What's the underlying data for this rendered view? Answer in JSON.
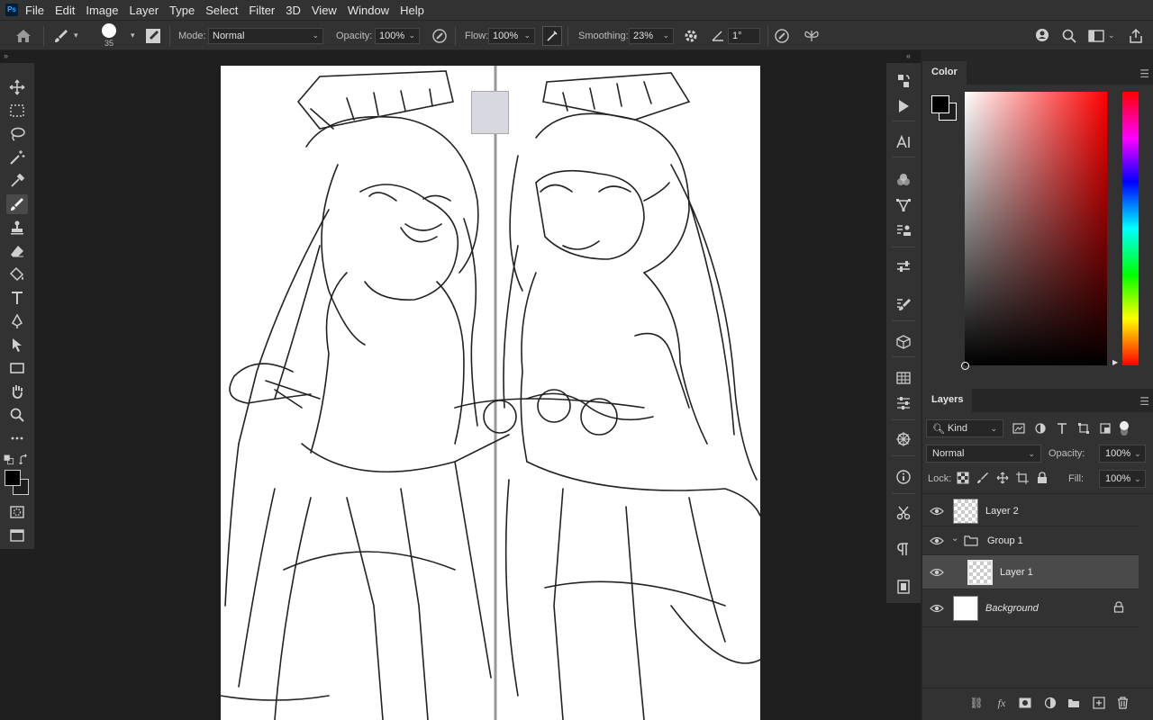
{
  "app": {
    "logo": "Ps"
  },
  "menu": [
    "File",
    "Edit",
    "Image",
    "Layer",
    "Type",
    "Select",
    "Filter",
    "3D",
    "View",
    "Window",
    "Help"
  ],
  "options": {
    "brush_size": "35",
    "mode_label": "Mode:",
    "mode_value": "Normal",
    "opacity_label": "Opacity:",
    "opacity_value": "100%",
    "flow_label": "Flow:",
    "flow_value": "100%",
    "smoothing_label": "Smoothing:",
    "smoothing_value": "23%",
    "angle_value": "1°"
  },
  "tools": [
    "move",
    "marquee",
    "lasso",
    "magic-wand",
    "eyedropper",
    "brush",
    "clone-stamp",
    "eraser",
    "paint-bucket",
    "type",
    "pen",
    "path-selection",
    "rectangle",
    "hand",
    "zoom",
    "more",
    "swap-colors",
    "color-swatches",
    "quick-mask",
    "screen-mode"
  ],
  "active_tool": "brush",
  "colors": {
    "foreground": "#000000",
    "background": "#1e1e1e",
    "hue": "#ff0000"
  },
  "color_panel": {
    "title": "Color"
  },
  "layers_panel": {
    "title": "Layers",
    "filter_kind": "Kind",
    "blend_mode": "Normal",
    "opacity_label": "Opacity:",
    "opacity_value": "100%",
    "lock_label": "Lock:",
    "fill_label": "Fill:",
    "fill_value": "100%",
    "layers": [
      {
        "name": "Layer 2",
        "type": "layer",
        "visible": true,
        "selected": false
      },
      {
        "name": "Group 1",
        "type": "group",
        "visible": true,
        "selected": false
      },
      {
        "name": "Layer 1",
        "type": "layer",
        "visible": true,
        "selected": true
      },
      {
        "name": "Background",
        "type": "background",
        "visible": true,
        "selected": false,
        "locked": true
      }
    ]
  }
}
